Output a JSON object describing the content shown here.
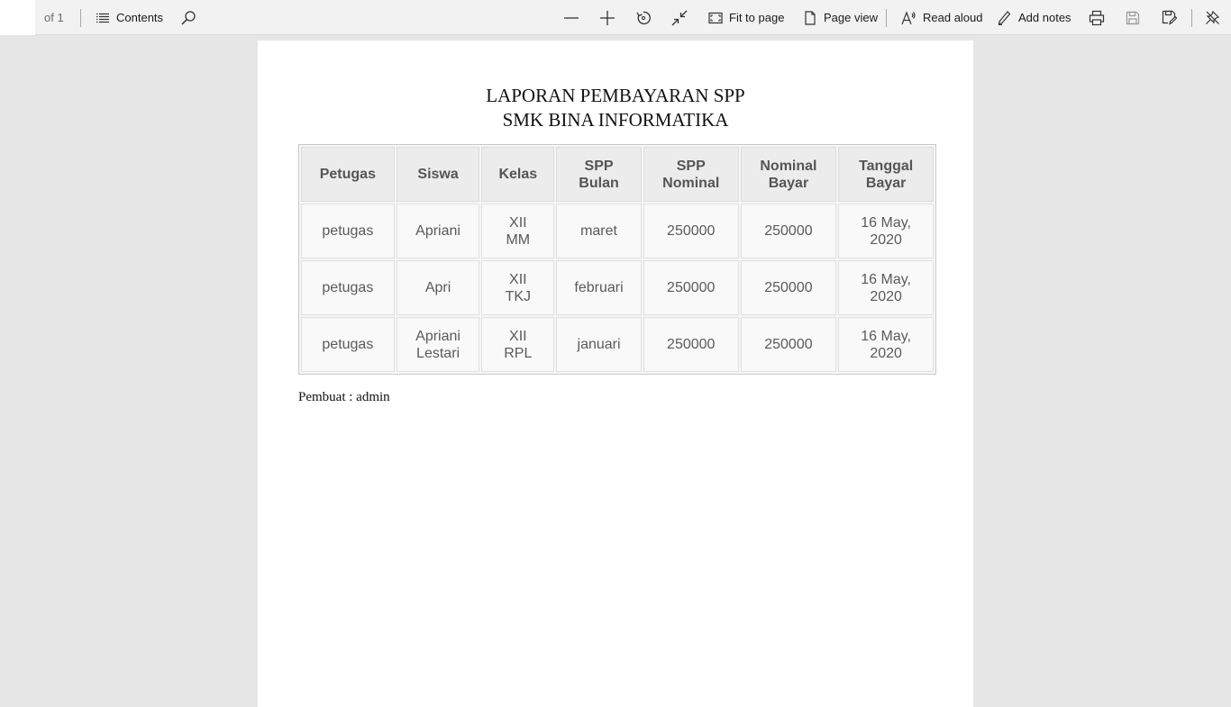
{
  "toolbar": {
    "page_total": "of 1",
    "contents_label": "Contents",
    "fit_to_page_label": "Fit to page",
    "page_view_label": "Page view",
    "read_aloud_label": "Read aloud",
    "add_notes_label": "Add notes",
    "icons": [
      "contents-icon",
      "search-icon",
      "zoom-out-icon",
      "zoom-in-icon",
      "rotate-icon",
      "collapse-icon",
      "fit-to-page-icon",
      "page-view-icon",
      "read-aloud-icon",
      "add-notes-icon",
      "print-icon",
      "save-icon",
      "save-as-icon",
      "unpin-icon"
    ]
  },
  "document": {
    "title_line1": "LAPORAN PEMBAYARAN SPP",
    "title_line2": "SMK BINA INFORMATIKA",
    "table": {
      "headers": [
        "Petugas",
        "Siswa",
        "Kelas",
        "SPP\nBulan",
        "SPP\nNominal",
        "Nominal\nBayar",
        "Tanggal\nBayar"
      ],
      "rows": [
        [
          "petugas",
          "Apriani",
          "XII\nMM",
          "maret",
          "250000",
          "250000",
          "16 May,\n2020"
        ],
        [
          "petugas",
          "Apri",
          "XII\nTKJ",
          "februari",
          "250000",
          "250000",
          "16 May,\n2020"
        ],
        [
          "petugas",
          "Apriani\nLestari",
          "XII\nRPL",
          "januari",
          "250000",
          "250000",
          "16 May,\n2020"
        ]
      ]
    },
    "author": "Pembuat : admin"
  }
}
